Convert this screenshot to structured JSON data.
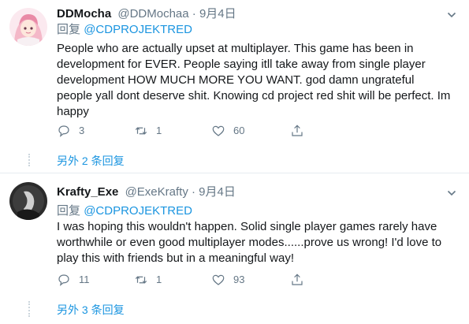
{
  "tweets": [
    {
      "name": "DDMocha",
      "handle": "@DDMochaa",
      "separator": "·",
      "date": "9月4日",
      "reply_prefix": "回复",
      "reply_mention": "@CDPROJEKTRED",
      "text": "People who are actually upset at multiplayer. This game has been in development for EVER. People saying itll take away from single player development HOW MUCH MORE YOU WANT.  god damn ungrateful people yall dont deserve shit. Knowing cd project red shit will be perfect. Im happy",
      "replies": "3",
      "retweets": "1",
      "likes": "60",
      "more_replies": "另外 2 条回复",
      "avatar_icon": "anime-avatar"
    },
    {
      "name": "Krafty_Exe",
      "handle": "@ExeKrafty",
      "separator": "·",
      "date": "9月4日",
      "reply_prefix": "回复",
      "reply_mention": "@CDPROJEKTRED",
      "text": "I was hoping this wouldn't happen. Solid single player games rarely have worthwhile or even good multiplayer modes......prove us wrong! I'd  love to play this with friends but in a meaningful way!",
      "replies": "11",
      "retweets": "1",
      "likes": "93",
      "more_replies": "另外 3 条回复",
      "avatar_icon": "dark-avatar"
    }
  ],
  "colors": {
    "link": "#1b95e0",
    "muted": "#657786",
    "text": "#14171a",
    "divider": "#e6ecf0"
  },
  "icons": {
    "reply": "reply-icon",
    "retweet": "retweet-icon",
    "like": "heart-icon",
    "share": "share-icon",
    "menu": "chevron-down-icon"
  }
}
